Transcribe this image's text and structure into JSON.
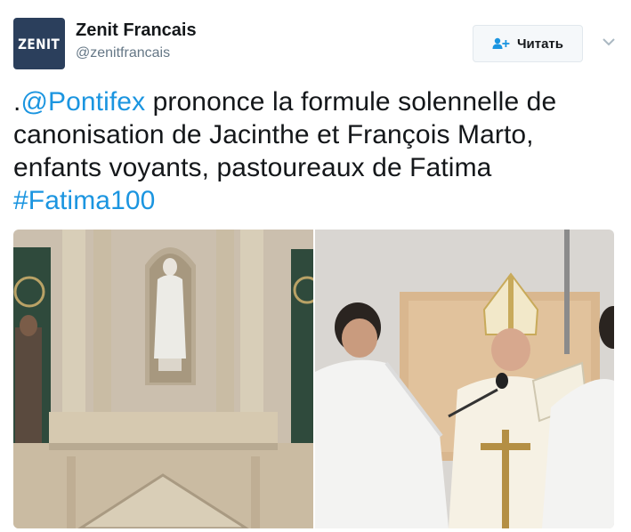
{
  "header": {
    "avatar_text": "ZENIT",
    "display_name": "Zenit Francais",
    "handle": "@zenitfrancais",
    "follow_label": "Читать"
  },
  "tweet": {
    "prefix": ".",
    "mention": "@Pontifex",
    "body": " prononce la formule solennelle de canonisation de Jacinthe et François Marto, enfants voyants, pastoureaux de Fatima ",
    "hashtag": "#Fatima100"
  },
  "media": {
    "images": [
      {
        "subject": "statue-in-niche-facade"
      },
      {
        "subject": "pope-at-microphone-with-altar-servers"
      }
    ]
  },
  "colors": {
    "link": "#1b95e0",
    "avatar_bg": "#2b3f5c",
    "secondary_text": "#657786"
  }
}
